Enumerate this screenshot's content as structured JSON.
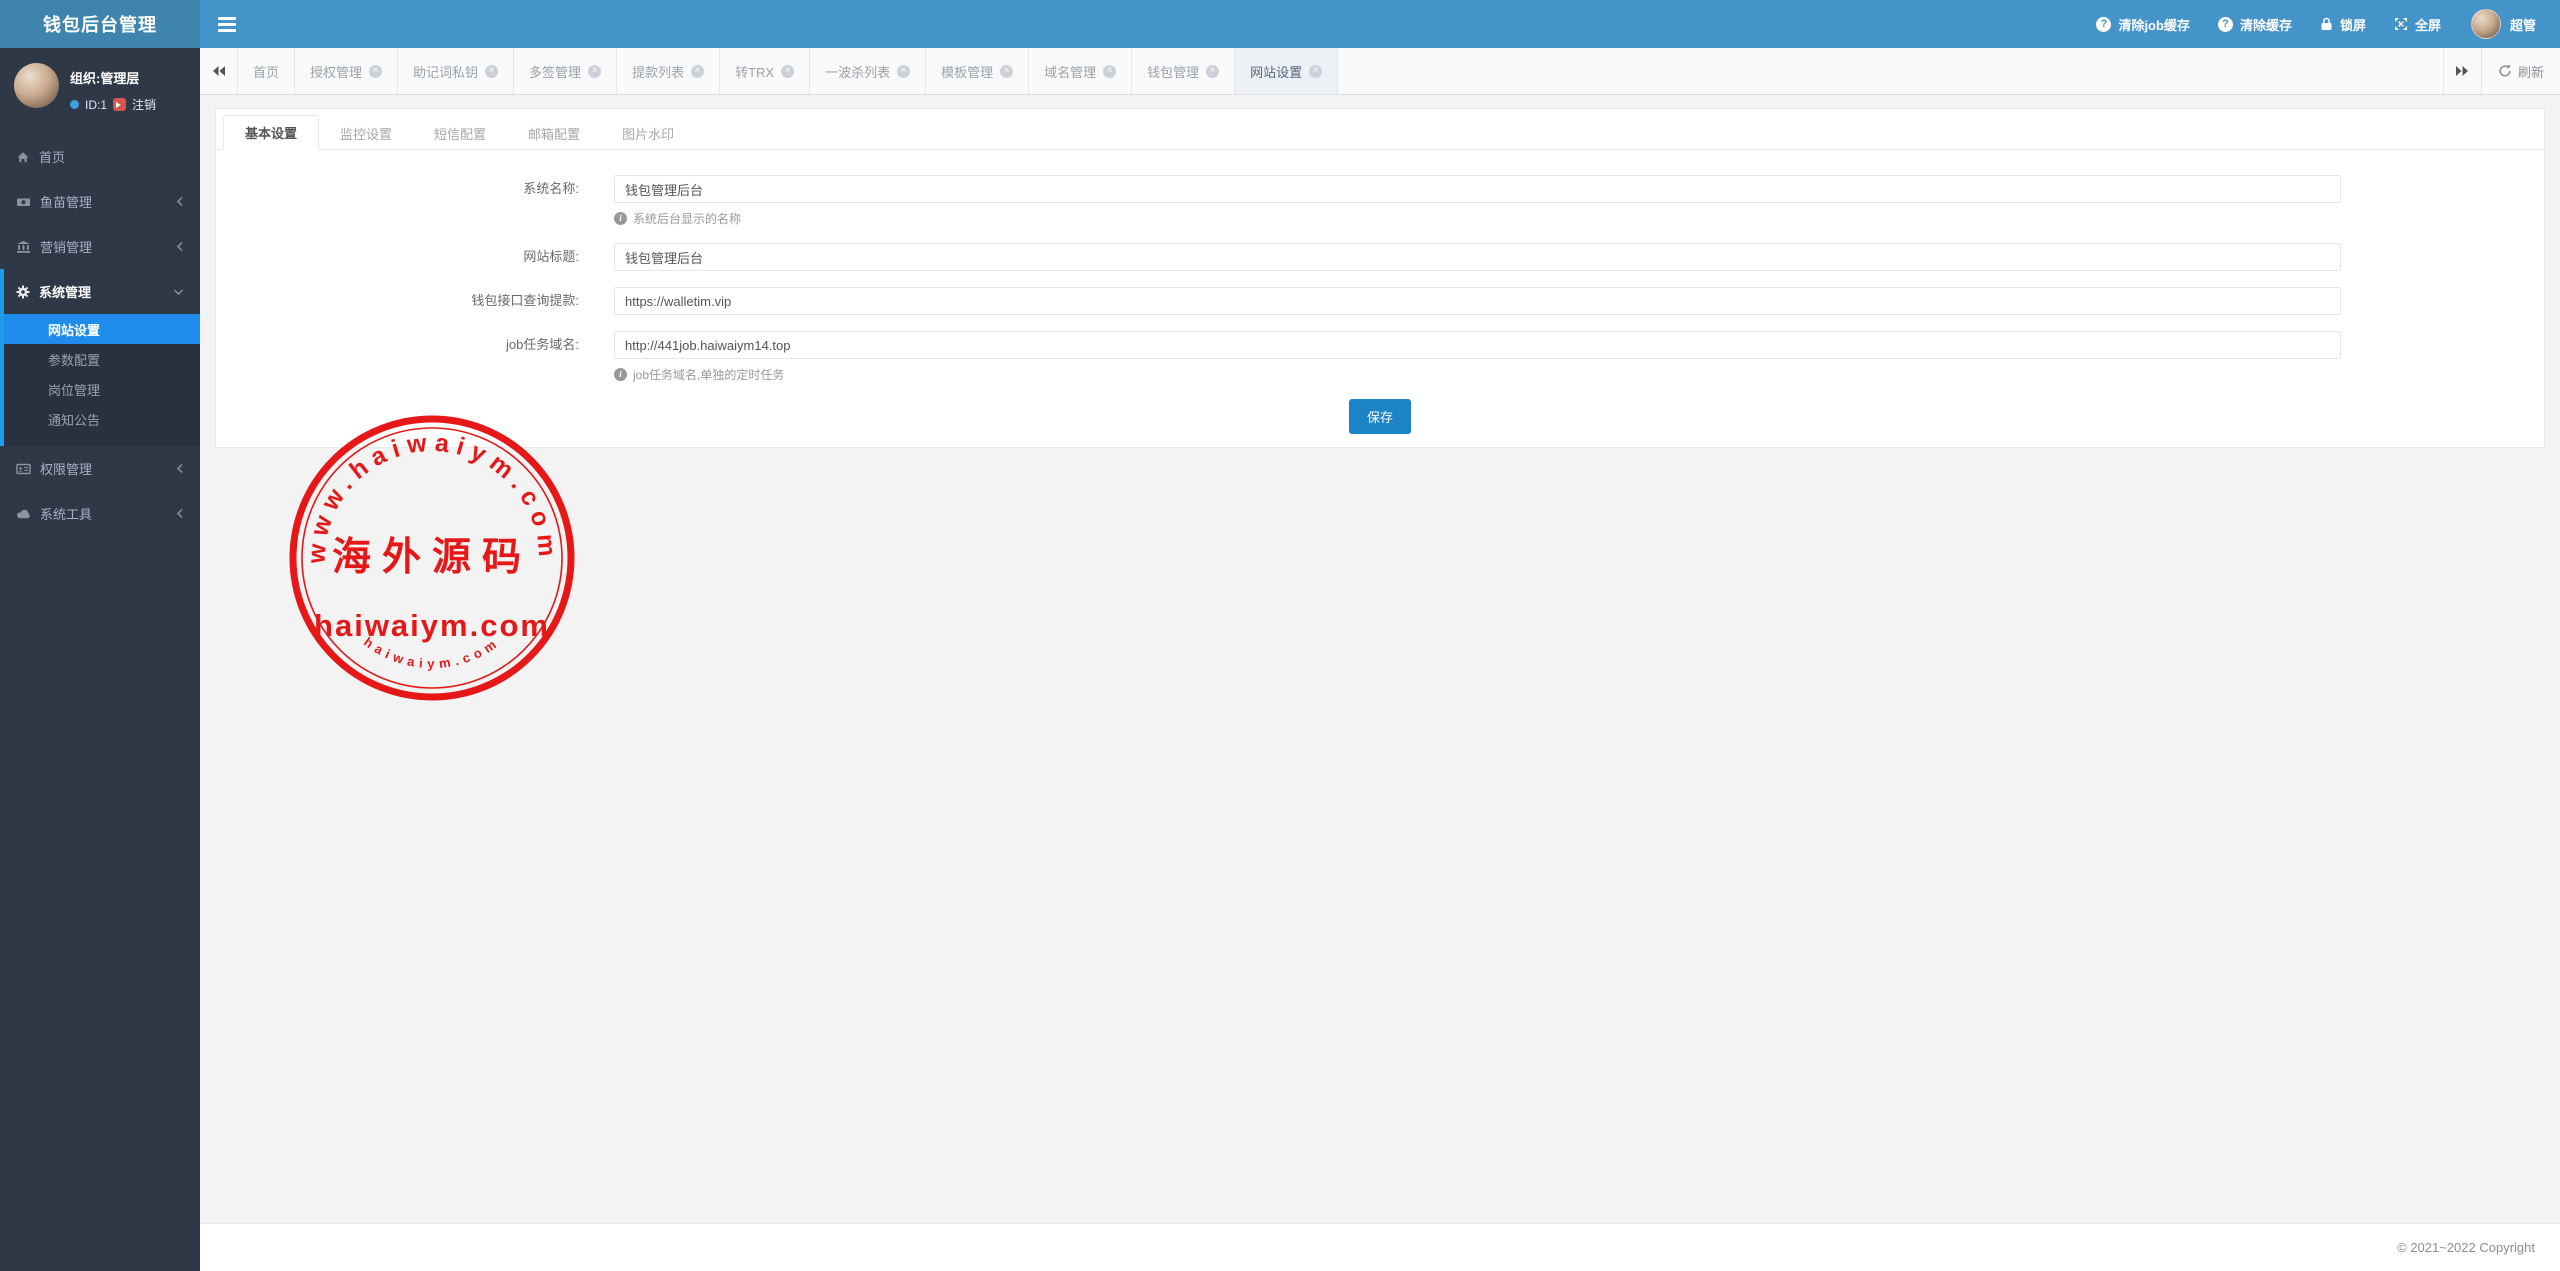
{
  "app": {
    "brand": "钱包后台管理"
  },
  "header": {
    "actions": [
      {
        "label": "清除job缓存",
        "icon": "question-circle-icon"
      },
      {
        "label": "清除缓存",
        "icon": "question-circle-icon"
      },
      {
        "label": "锁屏",
        "icon": "lock-icon"
      },
      {
        "label": "全屏",
        "icon": "fullscreen-icon"
      }
    ],
    "user": {
      "name": "超管"
    }
  },
  "sidebar": {
    "profile": {
      "org": "组织:管理层",
      "id": "ID:1",
      "logout": "注销"
    },
    "menu": [
      {
        "label": "首页",
        "icon": "home-icon"
      },
      {
        "label": "鱼苗管理",
        "icon": "money-icon",
        "state": "collapsed"
      },
      {
        "label": "营销管理",
        "icon": "bank-icon",
        "state": "collapsed"
      },
      {
        "label": "系统管理",
        "icon": "gear-icon",
        "state": "expanded",
        "children": [
          {
            "label": "网站设置",
            "active": true
          },
          {
            "label": "参数配置"
          },
          {
            "label": "岗位管理"
          },
          {
            "label": "通知公告"
          }
        ]
      },
      {
        "label": "权限管理",
        "icon": "idcard-icon",
        "state": "collapsed"
      },
      {
        "label": "系统工具",
        "icon": "cloud-icon",
        "state": "collapsed"
      }
    ]
  },
  "tabbar": {
    "tabs": [
      {
        "label": "首页",
        "closable": false
      },
      {
        "label": "授权管理",
        "closable": true
      },
      {
        "label": "助记词私钥",
        "closable": true
      },
      {
        "label": "多签管理",
        "closable": true
      },
      {
        "label": "提款列表",
        "closable": true
      },
      {
        "label": "转TRX",
        "closable": true
      },
      {
        "label": "一波杀列表",
        "closable": true
      },
      {
        "label": "模板管理",
        "closable": true
      },
      {
        "label": "域名管理",
        "closable": true
      },
      {
        "label": "钱包管理",
        "closable": true
      },
      {
        "label": "网站设置",
        "closable": true,
        "active": true
      }
    ],
    "refresh_label": "刷新"
  },
  "content": {
    "tabs": [
      {
        "label": "基本设置",
        "active": true
      },
      {
        "label": "监控设置"
      },
      {
        "label": "短信配置"
      },
      {
        "label": "邮箱配置"
      },
      {
        "label": "图片水印"
      }
    ],
    "form": {
      "fields": [
        {
          "label": "系统名称:",
          "value": "钱包管理后台",
          "help": "系统后台显示的名称"
        },
        {
          "label": "网站标题:",
          "value": "钱包管理后台",
          "help": ""
        },
        {
          "label": "钱包接口查询提款:",
          "value": "https://walletim.vip",
          "help": ""
        },
        {
          "label": "job任务域名:",
          "value": "http://441job.haiwaiym14.top",
          "help": "job任务域名,单独的定时任务"
        }
      ],
      "save_label": "保存"
    }
  },
  "watermark": {
    "arc_top": "www.haiwaiym.com",
    "center_cn": "海外源码",
    "center_en": "haiwaiym.com",
    "arc_bottom": "haiwaiym.com"
  },
  "footer": {
    "copyright": "© 2021~2022 Copyright"
  },
  "colors": {
    "header_blue": "#4493c9",
    "brand_blue": "#3e84ad",
    "sidebar_dark": "#2f3847",
    "submenu_dark": "#28313e",
    "active_item_blue": "#1f8ceb",
    "accent_strip_blue": "#209be8",
    "save_button_blue": "#1c84c6",
    "stamp_red": "#e60f0f",
    "body_gray": "#f3f3f4"
  }
}
